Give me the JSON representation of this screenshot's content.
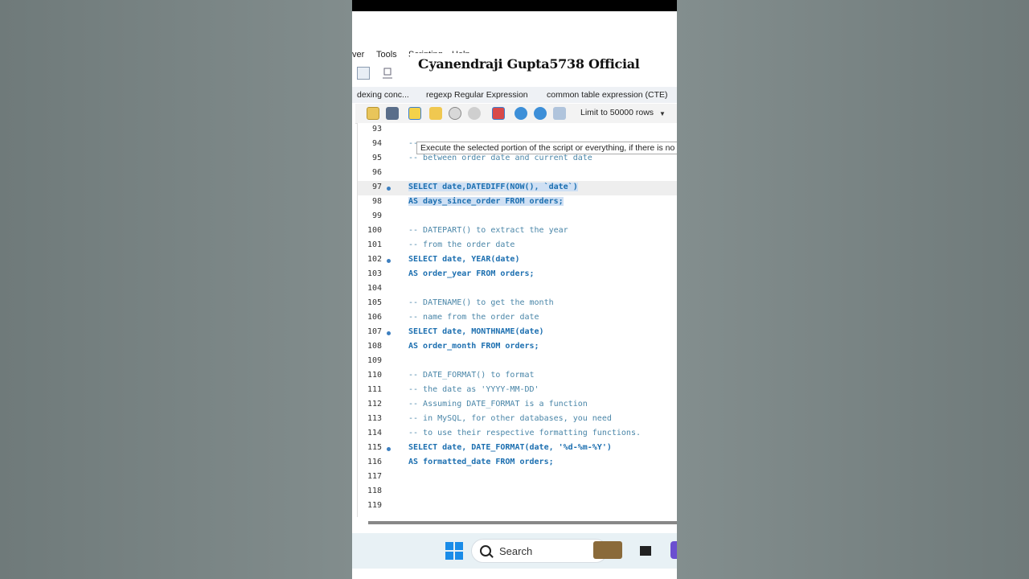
{
  "menu": {
    "items": [
      "ver",
      "Tools",
      "Scripting",
      "Help"
    ]
  },
  "brand": {
    "channel": "Gyanendraji Gupta5738 Official"
  },
  "tabs": [
    "dexing conc...",
    "regexp Regular Expression",
    "common table expression (CTE)"
  ],
  "toolbar": {
    "limit_label": "Limit to 50000 rows"
  },
  "tooltip": "Execute the selected portion of the script or everything, if there is no selection",
  "editor": {
    "lines": [
      {
        "n": "93",
        "text": ""
      },
      {
        "n": "94",
        "text": "-- "
      },
      {
        "n": "95",
        "text": "-- between order date and current date"
      },
      {
        "n": "96",
        "text": ""
      },
      {
        "n": "97",
        "text": "SELECT date,DATEDIFF(NOW(), `date`)"
      },
      {
        "n": "98",
        "text": "AS days_since_order FROM orders;"
      },
      {
        "n": "99",
        "text": ""
      },
      {
        "n": "100",
        "text": "-- DATEPART() to extract the year"
      },
      {
        "n": "101",
        "text": "-- from the order date"
      },
      {
        "n": "102",
        "text": "SELECT date, YEAR(date)"
      },
      {
        "n": "103",
        "text": "AS order_year FROM orders;"
      },
      {
        "n": "104",
        "text": ""
      },
      {
        "n": "105",
        "text": "-- DATENAME() to get the month"
      },
      {
        "n": "106",
        "text": "-- name from the order date"
      },
      {
        "n": "107",
        "text": "SELECT date, MONTHNAME(date)"
      },
      {
        "n": "108",
        "text": "AS order_month FROM orders;"
      },
      {
        "n": "109",
        "text": ""
      },
      {
        "n": "110",
        "text": "-- DATE_FORMAT() to format"
      },
      {
        "n": "111",
        "text": "-- the date as 'YYYY-MM-DD'"
      },
      {
        "n": "112",
        "text": "-- Assuming DATE_FORMAT is a function"
      },
      {
        "n": "113",
        "text": "-- in MySQL, for other databases, you need"
      },
      {
        "n": "114",
        "text": "-- to use their respective formatting functions."
      },
      {
        "n": "115",
        "text": "SELECT date, DATE_FORMAT(date, '%d-%m-%Y')"
      },
      {
        "n": "116",
        "text": "AS formatted_date FROM orders;"
      },
      {
        "n": "117",
        "text": ""
      },
      {
        "n": "118",
        "text": ""
      },
      {
        "n": "119",
        "text": ""
      }
    ]
  },
  "taskbar": {
    "search_label": "Search"
  }
}
